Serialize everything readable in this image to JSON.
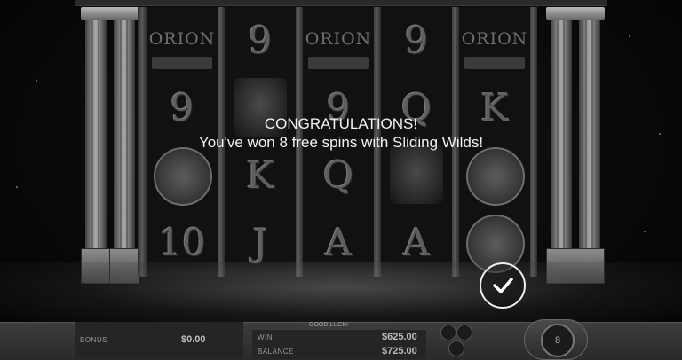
{
  "message": {
    "line1": "CONGRATULATIONS!",
    "line2": "You've won 8 free spins with Sliding Wilds!"
  },
  "confirm_icon": "checkmark-icon",
  "reels": [
    {
      "id": "reel1",
      "symbols": [
        {
          "type": "logo",
          "text": "ORION"
        },
        {
          "type": "letter",
          "text": "9"
        },
        {
          "type": "medal",
          "text": ""
        },
        {
          "type": "letter",
          "text": "10"
        }
      ]
    },
    {
      "id": "reel2",
      "symbols": [
        {
          "type": "letter",
          "text": "9"
        },
        {
          "type": "image",
          "text": ""
        },
        {
          "type": "letter",
          "text": "K"
        },
        {
          "type": "letter",
          "text": "J"
        }
      ]
    },
    {
      "id": "reel3",
      "symbols": [
        {
          "type": "logo",
          "text": "ORION"
        },
        {
          "type": "letter",
          "text": "9"
        },
        {
          "type": "letter",
          "text": "Q"
        },
        {
          "type": "letter",
          "text": "A"
        }
      ]
    },
    {
      "id": "reel4",
      "symbols": [
        {
          "type": "letter",
          "text": "9"
        },
        {
          "type": "letter",
          "text": "Q"
        },
        {
          "type": "image",
          "text": ""
        },
        {
          "type": "letter",
          "text": "A"
        }
      ]
    },
    {
      "id": "reel5",
      "symbols": [
        {
          "type": "logo",
          "text": "ORION"
        },
        {
          "type": "letter",
          "text": "K"
        },
        {
          "type": "medal",
          "text": ""
        },
        {
          "type": "image",
          "text": ""
        }
      ]
    }
  ],
  "bottom": {
    "bonus_label": "BONUS",
    "bonus_value": "$0.00",
    "good_luck": "GOOD LUCK!",
    "win_label": "WIN",
    "win_value": "$625.00",
    "balance_label": "BALANCE",
    "balance_value": "$725.00",
    "spin_count": "8"
  }
}
